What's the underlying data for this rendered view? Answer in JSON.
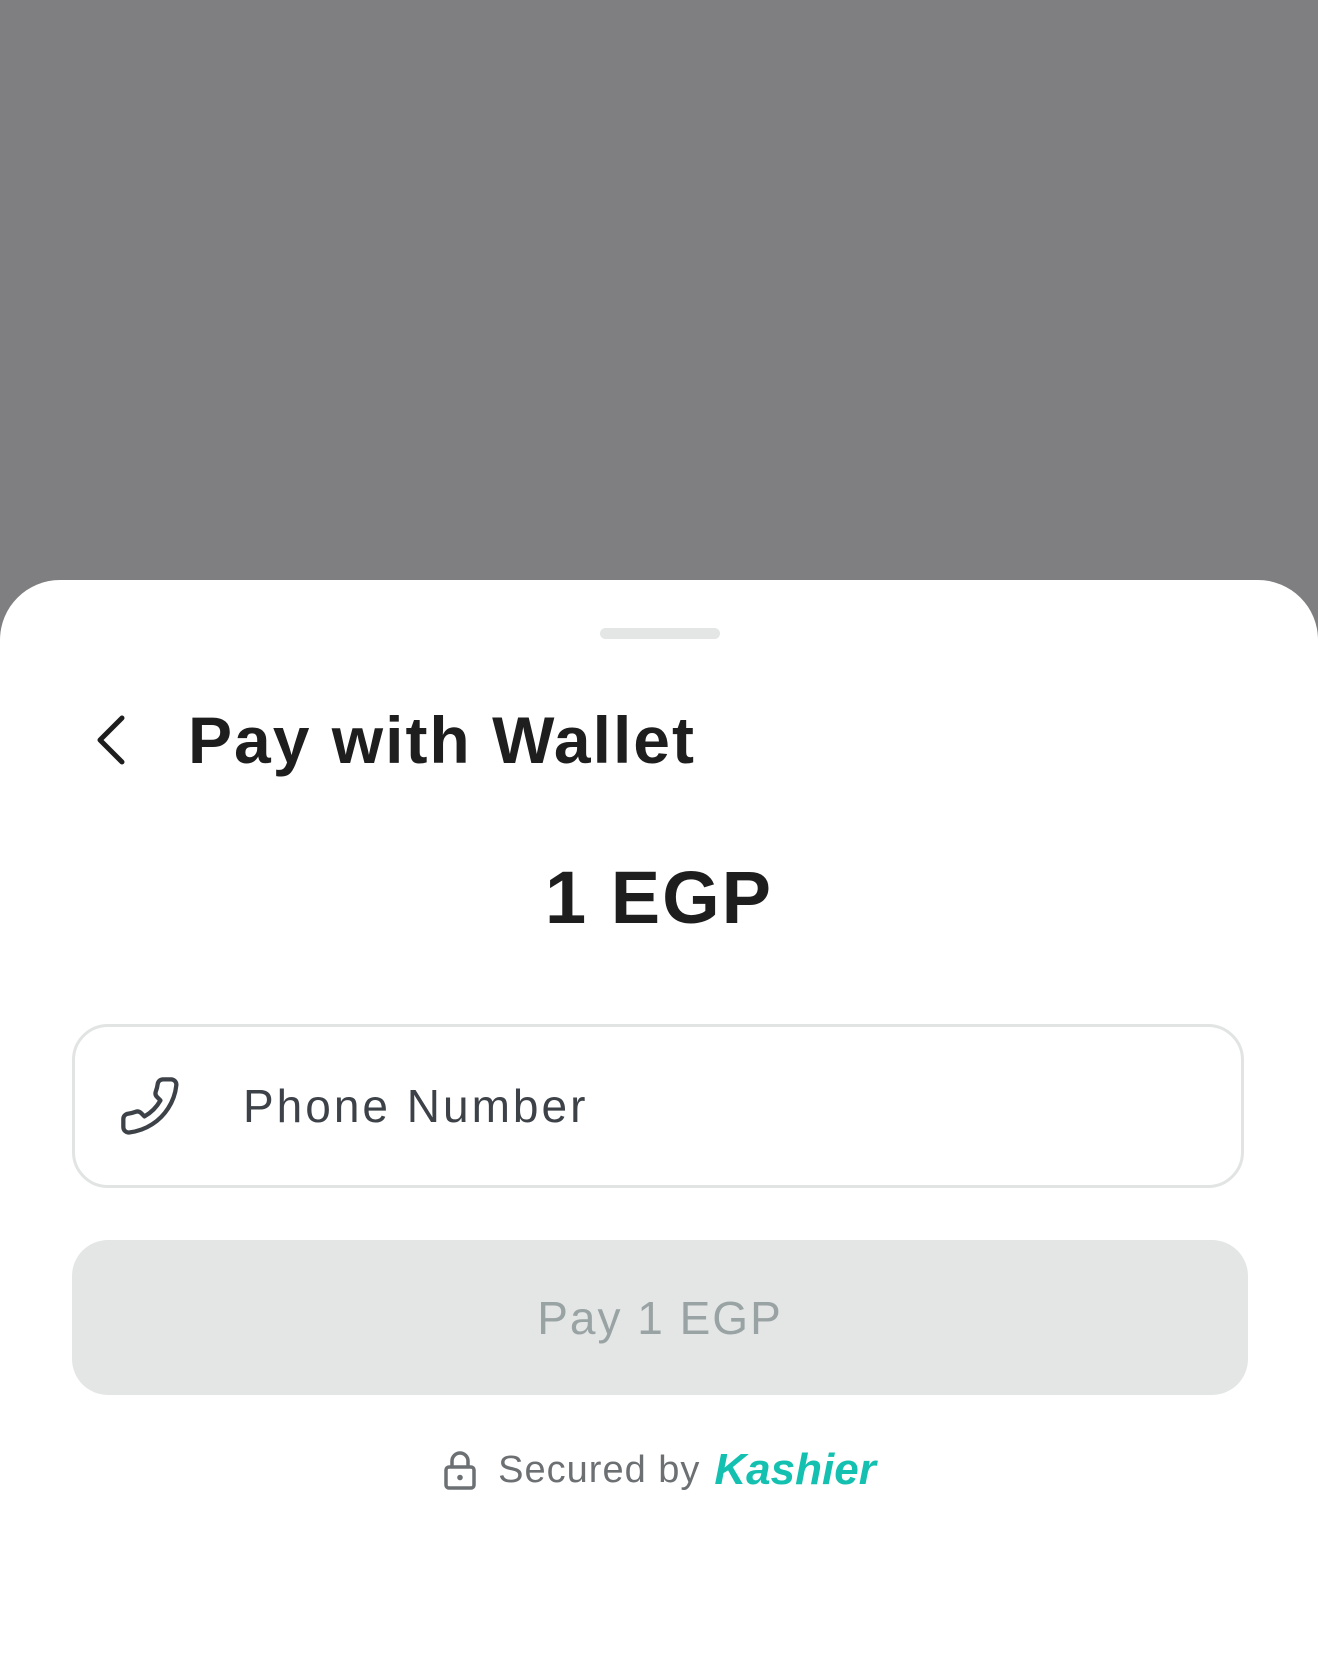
{
  "header": {
    "title": "Pay with Wallet",
    "back_icon": "chevron-left-icon"
  },
  "amount": "1 EGP",
  "phone_field": {
    "placeholder": "Phone Number",
    "value": "",
    "icon": "phone-icon"
  },
  "pay_button": {
    "label": "Pay 1 EGP",
    "enabled": false
  },
  "footer": {
    "secured_label": "Secured by",
    "brand": "Kashier",
    "lock_icon": "lock-icon"
  },
  "colors": {
    "backdrop": "#7f7f81",
    "sheet": "#ffffff",
    "brand_accent": "#14c1b0",
    "disabled_button_bg": "#e4e6e6",
    "disabled_button_text": "#9aa3a3",
    "title_text": "#1e1e1e"
  }
}
